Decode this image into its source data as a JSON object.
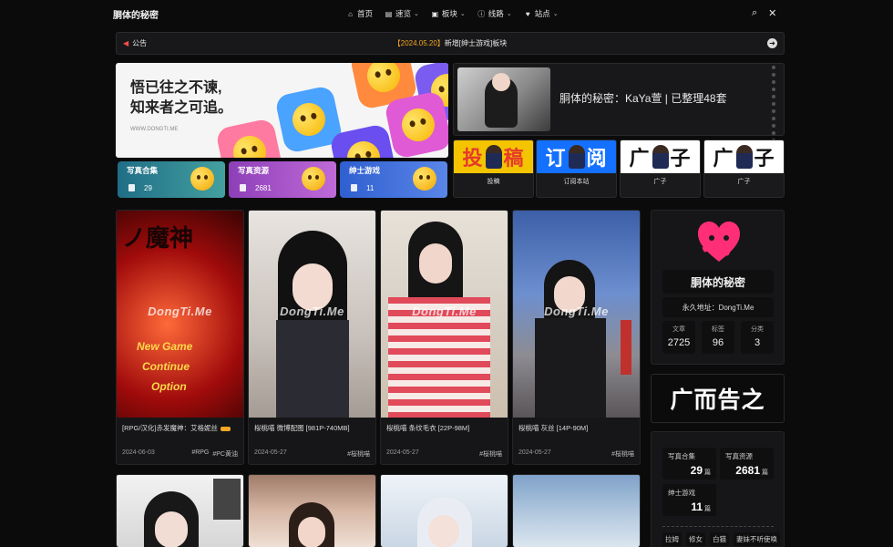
{
  "header": {
    "logo": "胴体的秘密",
    "nav": [
      {
        "icon": "home-icon",
        "label": "首页",
        "dropdown": false
      },
      {
        "icon": "book-icon",
        "label": "速览",
        "dropdown": true
      },
      {
        "icon": "image-icon",
        "label": "板块",
        "dropdown": true
      },
      {
        "icon": "info-icon",
        "label": "线路",
        "dropdown": true
      },
      {
        "icon": "heart-icon",
        "label": "站点",
        "dropdown": true
      }
    ],
    "search_icon": "search-icon",
    "tools_icon": "tools-icon"
  },
  "notice": {
    "label": "公告",
    "date": "【2024.05.20】",
    "text": "新增[绅士游戏]板块"
  },
  "banner": {
    "line1": "悟已往之不谏,",
    "line2": "知来者之可追。",
    "url": "WWW.DONGTI.ME"
  },
  "feature": {
    "title": "胴体的秘密：KaYa萱 | 已整理48套"
  },
  "categories": [
    {
      "name": "写真合集",
      "count": "29",
      "color": "#2f8f9a"
    },
    {
      "name": "写真资源",
      "count": "2681",
      "color": "#a55bc4"
    },
    {
      "name": "绅士游戏",
      "count": "11",
      "color": "#3f6fd1"
    }
  ],
  "ad_slots": [
    {
      "text": "投稿",
      "caption": "投稿"
    },
    {
      "text": "订阅",
      "caption": "订阅本站"
    },
    {
      "text": "广子",
      "caption": "广子"
    },
    {
      "text": "广子",
      "caption": "广子"
    }
  ],
  "posts": [
    {
      "title": "[RPG/汉化]赤发魔神：艾格妮丝",
      "date": "2024-06-03",
      "tags": [
        "#RPG",
        "#PC黄油"
      ],
      "watermark": "DongTi.Me"
    },
    {
      "title": "桜桃喵 微博配图 [981P-740MB]",
      "date": "2024-05-27",
      "tags": [
        "#桜桃喵"
      ],
      "watermark": "DongTi.Me"
    },
    {
      "title": "桜桃喵 条纹毛衣 [22P-98M]",
      "date": "2024-05-27",
      "tags": [
        "#桜桃喵"
      ],
      "watermark": "DongTi.Me"
    },
    {
      "title": "桜桃喵 灰丝 [14P-90M]",
      "date": "2024-05-27",
      "tags": [
        "#桜桃喵"
      ],
      "watermark": "DongTi.Me"
    }
  ],
  "sidebar": {
    "site_name": "胴体的秘密",
    "permalink": "永久地址：DongTi.Me",
    "stats": [
      {
        "label": "文章",
        "value": "2725"
      },
      {
        "label": "标签",
        "value": "96"
      },
      {
        "label": "分类",
        "value": "3"
      }
    ],
    "ad_text": "广而告之",
    "mini": [
      {
        "label": "写真合集",
        "value": "29",
        "unit": "篇"
      },
      {
        "label": "写真资源",
        "value": "2681",
        "unit": "篇"
      },
      {
        "label": "绅士游戏",
        "value": "11",
        "unit": "篇"
      }
    ],
    "tags": [
      "拉姆",
      "修女",
      "白猫",
      "妻妹不听使唤"
    ]
  }
}
